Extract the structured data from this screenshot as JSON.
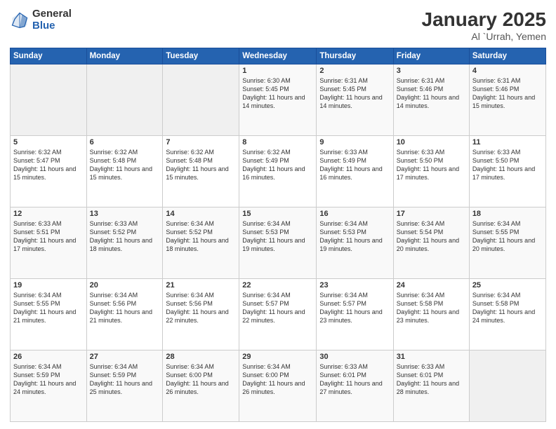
{
  "logo": {
    "general": "General",
    "blue": "Blue"
  },
  "title": {
    "month": "January 2025",
    "location": "Al `Urrah, Yemen"
  },
  "weekdays": [
    "Sunday",
    "Monday",
    "Tuesday",
    "Wednesday",
    "Thursday",
    "Friday",
    "Saturday"
  ],
  "weeks": [
    [
      {
        "day": "",
        "info": ""
      },
      {
        "day": "",
        "info": ""
      },
      {
        "day": "",
        "info": ""
      },
      {
        "day": "1",
        "info": "Sunrise: 6:30 AM\nSunset: 5:45 PM\nDaylight: 11 hours and 14 minutes."
      },
      {
        "day": "2",
        "info": "Sunrise: 6:31 AM\nSunset: 5:45 PM\nDaylight: 11 hours and 14 minutes."
      },
      {
        "day": "3",
        "info": "Sunrise: 6:31 AM\nSunset: 5:46 PM\nDaylight: 11 hours and 14 minutes."
      },
      {
        "day": "4",
        "info": "Sunrise: 6:31 AM\nSunset: 5:46 PM\nDaylight: 11 hours and 15 minutes."
      }
    ],
    [
      {
        "day": "5",
        "info": "Sunrise: 6:32 AM\nSunset: 5:47 PM\nDaylight: 11 hours and 15 minutes."
      },
      {
        "day": "6",
        "info": "Sunrise: 6:32 AM\nSunset: 5:48 PM\nDaylight: 11 hours and 15 minutes."
      },
      {
        "day": "7",
        "info": "Sunrise: 6:32 AM\nSunset: 5:48 PM\nDaylight: 11 hours and 15 minutes."
      },
      {
        "day": "8",
        "info": "Sunrise: 6:32 AM\nSunset: 5:49 PM\nDaylight: 11 hours and 16 minutes."
      },
      {
        "day": "9",
        "info": "Sunrise: 6:33 AM\nSunset: 5:49 PM\nDaylight: 11 hours and 16 minutes."
      },
      {
        "day": "10",
        "info": "Sunrise: 6:33 AM\nSunset: 5:50 PM\nDaylight: 11 hours and 17 minutes."
      },
      {
        "day": "11",
        "info": "Sunrise: 6:33 AM\nSunset: 5:50 PM\nDaylight: 11 hours and 17 minutes."
      }
    ],
    [
      {
        "day": "12",
        "info": "Sunrise: 6:33 AM\nSunset: 5:51 PM\nDaylight: 11 hours and 17 minutes."
      },
      {
        "day": "13",
        "info": "Sunrise: 6:33 AM\nSunset: 5:52 PM\nDaylight: 11 hours and 18 minutes."
      },
      {
        "day": "14",
        "info": "Sunrise: 6:34 AM\nSunset: 5:52 PM\nDaylight: 11 hours and 18 minutes."
      },
      {
        "day": "15",
        "info": "Sunrise: 6:34 AM\nSunset: 5:53 PM\nDaylight: 11 hours and 19 minutes."
      },
      {
        "day": "16",
        "info": "Sunrise: 6:34 AM\nSunset: 5:53 PM\nDaylight: 11 hours and 19 minutes."
      },
      {
        "day": "17",
        "info": "Sunrise: 6:34 AM\nSunset: 5:54 PM\nDaylight: 11 hours and 20 minutes."
      },
      {
        "day": "18",
        "info": "Sunrise: 6:34 AM\nSunset: 5:55 PM\nDaylight: 11 hours and 20 minutes."
      }
    ],
    [
      {
        "day": "19",
        "info": "Sunrise: 6:34 AM\nSunset: 5:55 PM\nDaylight: 11 hours and 21 minutes."
      },
      {
        "day": "20",
        "info": "Sunrise: 6:34 AM\nSunset: 5:56 PM\nDaylight: 11 hours and 21 minutes."
      },
      {
        "day": "21",
        "info": "Sunrise: 6:34 AM\nSunset: 5:56 PM\nDaylight: 11 hours and 22 minutes."
      },
      {
        "day": "22",
        "info": "Sunrise: 6:34 AM\nSunset: 5:57 PM\nDaylight: 11 hours and 22 minutes."
      },
      {
        "day": "23",
        "info": "Sunrise: 6:34 AM\nSunset: 5:57 PM\nDaylight: 11 hours and 23 minutes."
      },
      {
        "day": "24",
        "info": "Sunrise: 6:34 AM\nSunset: 5:58 PM\nDaylight: 11 hours and 23 minutes."
      },
      {
        "day": "25",
        "info": "Sunrise: 6:34 AM\nSunset: 5:58 PM\nDaylight: 11 hours and 24 minutes."
      }
    ],
    [
      {
        "day": "26",
        "info": "Sunrise: 6:34 AM\nSunset: 5:59 PM\nDaylight: 11 hours and 24 minutes."
      },
      {
        "day": "27",
        "info": "Sunrise: 6:34 AM\nSunset: 5:59 PM\nDaylight: 11 hours and 25 minutes."
      },
      {
        "day": "28",
        "info": "Sunrise: 6:34 AM\nSunset: 6:00 PM\nDaylight: 11 hours and 26 minutes."
      },
      {
        "day": "29",
        "info": "Sunrise: 6:34 AM\nSunset: 6:00 PM\nDaylight: 11 hours and 26 minutes."
      },
      {
        "day": "30",
        "info": "Sunrise: 6:33 AM\nSunset: 6:01 PM\nDaylight: 11 hours and 27 minutes."
      },
      {
        "day": "31",
        "info": "Sunrise: 6:33 AM\nSunset: 6:01 PM\nDaylight: 11 hours and 28 minutes."
      },
      {
        "day": "",
        "info": ""
      }
    ]
  ]
}
